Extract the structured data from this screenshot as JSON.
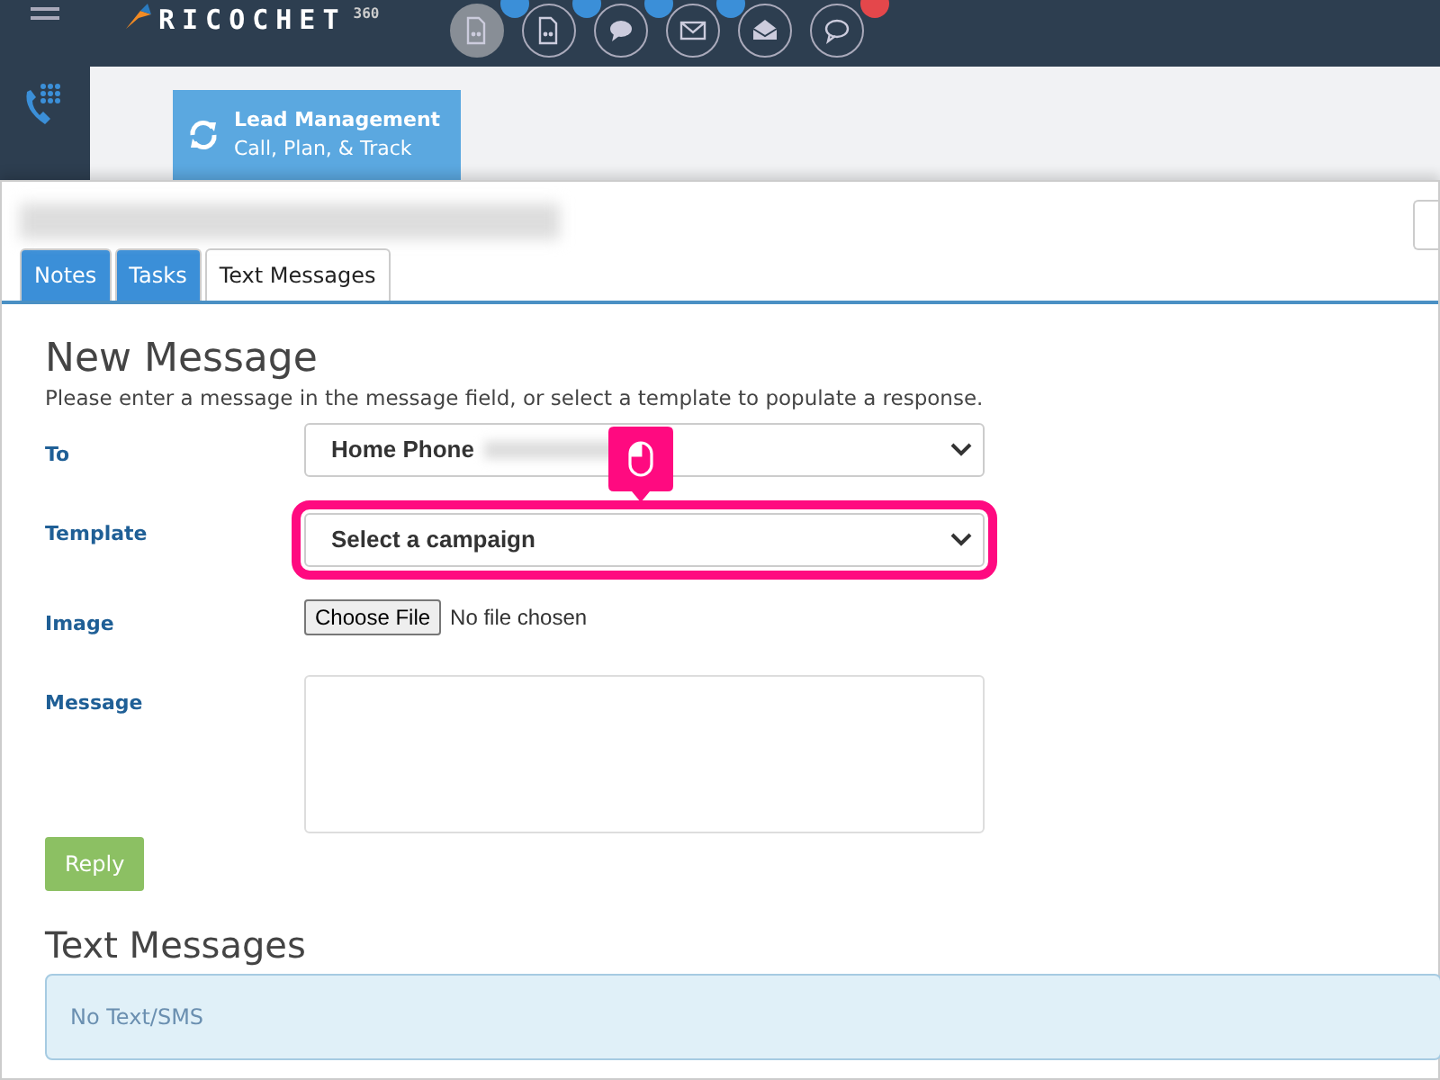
{
  "navbar": {
    "logo": "RICOCHET",
    "logo_sup": "360",
    "icons": [
      {
        "kind": "voicemail",
        "selected": true,
        "color": "#3b8fd8"
      },
      {
        "kind": "voicemail",
        "selected": false,
        "color": "#3b8fd8"
      },
      {
        "kind": "chat",
        "selected": false,
        "color": "#3b8fd8"
      },
      {
        "kind": "mail",
        "selected": false,
        "color": "#3b8fd8"
      },
      {
        "kind": "mail-open",
        "selected": false
      },
      {
        "kind": "bubble",
        "selected": false,
        "color": "#e4474b"
      }
    ]
  },
  "lead_card": {
    "title": "Lead Management",
    "subtitle": "Call, Plan, & Track"
  },
  "tabs": [
    {
      "label": "Notes",
      "selected": false
    },
    {
      "label": "Tasks",
      "selected": false
    },
    {
      "label": "Text Messages",
      "selected": true
    }
  ],
  "form": {
    "title": "New Message",
    "hint": "Please enter a message in the message field, or select a template to populate a response.",
    "rows": [
      {
        "label": "To",
        "kind": "select",
        "value": "Home Phone",
        "highlighted": false
      },
      {
        "label": "Template",
        "kind": "select",
        "value": "Select a campaign",
        "highlighted": true
      },
      {
        "label": "Image",
        "kind": "file",
        "button": "Choose File",
        "value": "No file chosen"
      },
      {
        "label": "Message",
        "kind": "textarea"
      }
    ],
    "submit": "Reply"
  },
  "messages": {
    "title": "Text Messages",
    "empty": "No Text/SMS"
  }
}
